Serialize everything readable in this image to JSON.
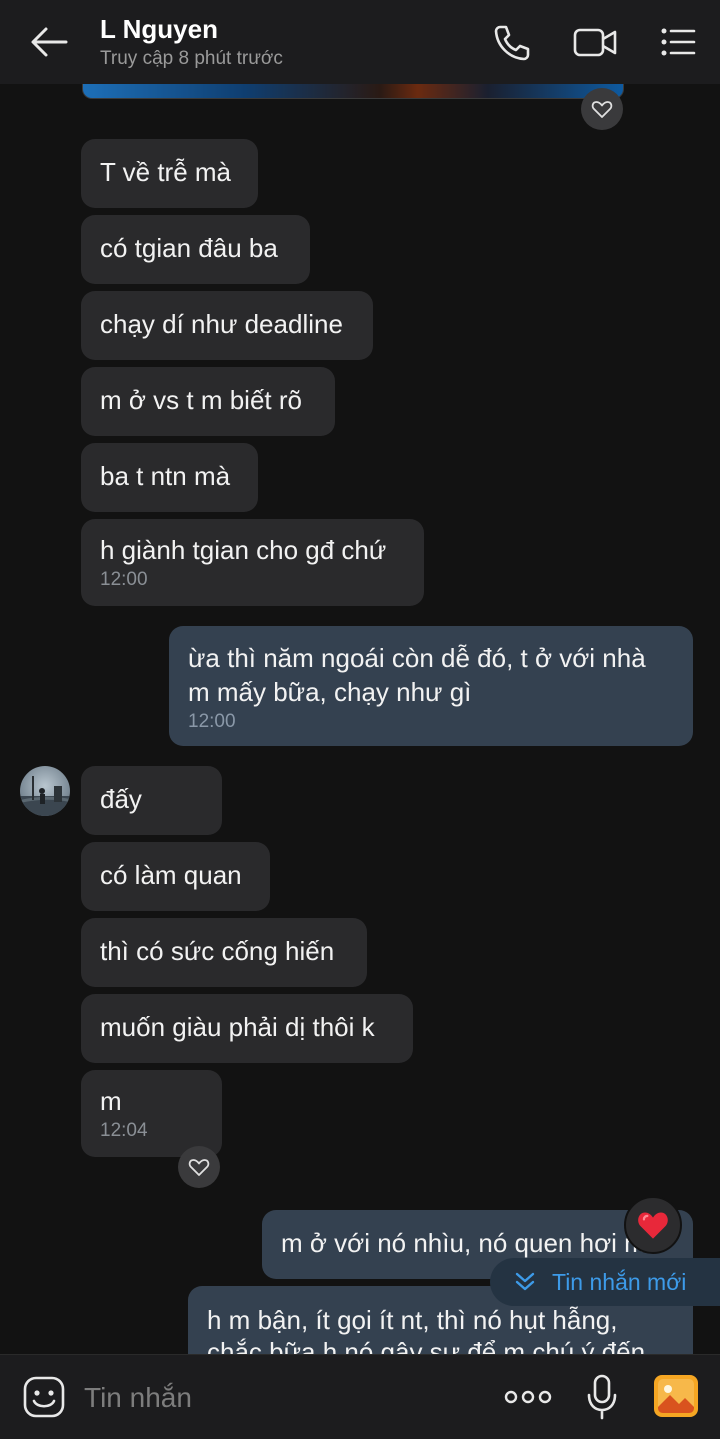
{
  "header": {
    "title": "L Nguyen",
    "subtitle": "Truy cập 8 phút trước",
    "icons": [
      "back-arrow-icon",
      "phone-icon",
      "video-call-icon",
      "menu-list-icon"
    ]
  },
  "messages": [
    {
      "side": "in",
      "text": "T về trễ mà"
    },
    {
      "side": "in",
      "text": "có tgian đâu ba"
    },
    {
      "side": "in",
      "text": "chạy dí như deadline"
    },
    {
      "side": "in",
      "text": "m ở vs t m biết rõ"
    },
    {
      "side": "in",
      "text": "ba t ntn mà"
    },
    {
      "side": "in",
      "text": "h giành tgian cho gđ chứ",
      "time": "12:00"
    },
    {
      "side": "out",
      "text": "ừa thì năm ngoái còn dễ đó, t ở với nhà m mấy bữa, chạy như gì",
      "time": "12:00"
    },
    {
      "side": "in",
      "text": "đấy"
    },
    {
      "side": "in",
      "text": "có làm quan"
    },
    {
      "side": "in",
      "text": "thì có sức cống hiến"
    },
    {
      "side": "in",
      "text": "muốn giàu phải dị thôi k"
    },
    {
      "side": "in",
      "text": "m",
      "time": "12:04"
    },
    {
      "side": "out",
      "text": "m ở với nó nhìu, nó quen hơi m r"
    },
    {
      "side": "out",
      "text": "h m bận, ít gọi ít nt, thì nó hụt hẫng, chắc bữa h nó gây sự để m chú ý đến"
    }
  ],
  "new_message_pill": {
    "label": "Tin nhắn mới"
  },
  "composer": {
    "placeholder": "Tin nhắn"
  },
  "colors": {
    "background": "#121212",
    "incoming_bubble": "#2a2a2c",
    "outgoing_bubble": "#344150",
    "accent": "#3d9be9",
    "reaction_heart": "#e8283a"
  }
}
